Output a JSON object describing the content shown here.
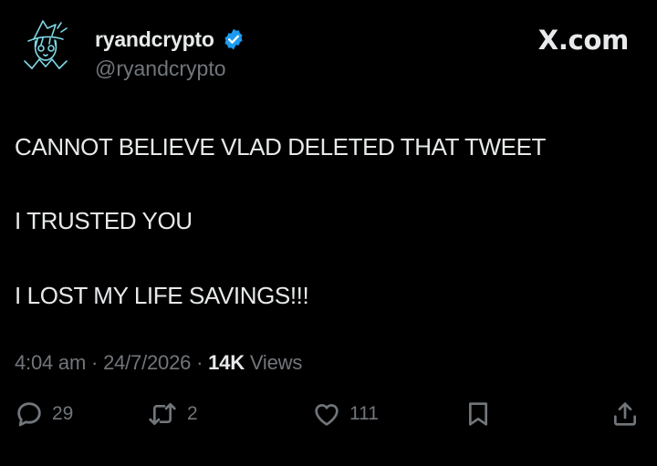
{
  "author": {
    "display_name": "ryandcrypto",
    "handle": "@ryandcrypto",
    "verified": true,
    "avatar_icon": "anime-wizard-avatar-icon"
  },
  "brand": {
    "label": "X.com"
  },
  "tweet": {
    "lines": [
      "CANNOT BELIEVE VLAD DELETED THAT TWEET",
      "I TRUSTED YOU",
      "I LOST MY LIFE SAVINGS!!!"
    ]
  },
  "meta": {
    "time": "4:04 am",
    "separator": "·",
    "date": "24/7/2026",
    "views_count": "14K",
    "views_label": "Views"
  },
  "actions": {
    "reply_count": "29",
    "retweet_count": "2",
    "like_count": "111"
  },
  "colors": {
    "background": "#000000",
    "text": "#e7e9ea",
    "secondary": "#71767b",
    "verified": "#1d9bf0",
    "avatar_line": "#7fd8e6"
  }
}
